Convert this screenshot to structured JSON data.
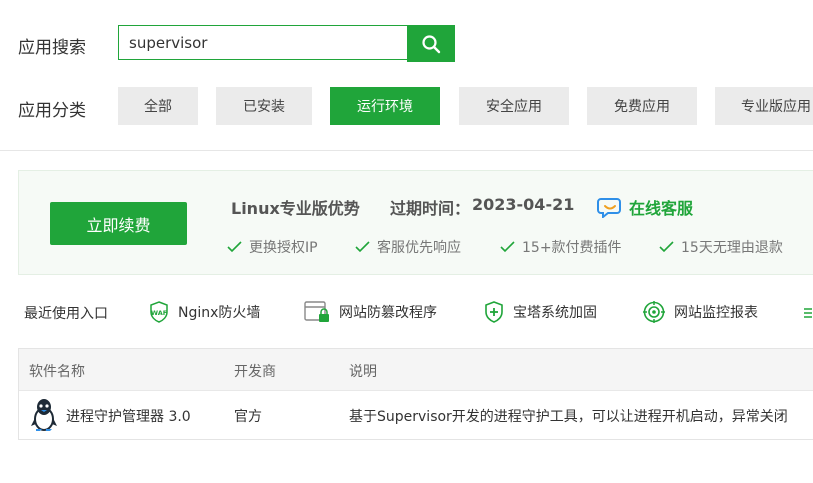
{
  "search": {
    "label": "应用搜索",
    "value": "supervisor",
    "button_icon": "search-icon"
  },
  "categories": {
    "label": "应用分类",
    "items": [
      {
        "label": "全部",
        "active": false
      },
      {
        "label": "已安装",
        "active": false
      },
      {
        "label": "运行环境",
        "active": true
      },
      {
        "label": "安全应用",
        "active": false
      },
      {
        "label": "免费应用",
        "active": false
      },
      {
        "label": "专业版应用",
        "active": false
      }
    ]
  },
  "promo": {
    "renew_button": "立即续费",
    "title": "Linux专业版优势",
    "expire_label": "过期时间：",
    "expire_date": "2023-04-21",
    "service_label": "在线客服",
    "features": [
      "更换授权IP",
      "客服优先响应",
      "15+款付费插件",
      "15天无理由退款"
    ]
  },
  "recent": {
    "title": "最近使用入口",
    "items": [
      {
        "label": "Nginx防火墙",
        "icon": "waf-shield-icon"
      },
      {
        "label": "网站防篡改程序",
        "icon": "browser-lock-icon"
      },
      {
        "label": "宝塔系统加固",
        "icon": "shield-plus-icon"
      },
      {
        "label": "网站监控报表",
        "icon": "monitor-target-icon"
      }
    ]
  },
  "table": {
    "headers": [
      "软件名称",
      "开发商",
      "说明"
    ],
    "rows": [
      {
        "name": "进程守护管理器 3.0",
        "vendor": "官方",
        "description": "基于Supervisor开发的进程守护工具，可以让进程开机启动，异常关闭",
        "icon": "linux-penguin-icon"
      }
    ]
  },
  "colors": {
    "accent": "#20a53a",
    "button_gray": "#ebebeb",
    "promo_bg": "#f6faf6"
  }
}
